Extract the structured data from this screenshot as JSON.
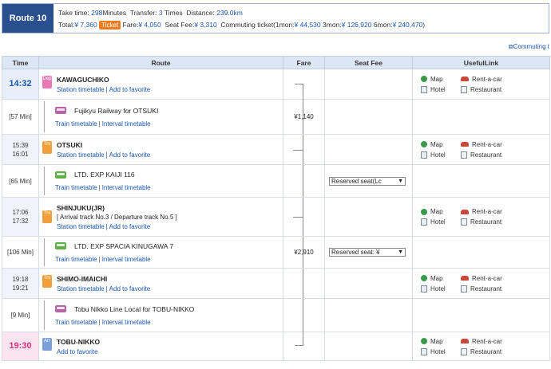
{
  "summary": {
    "route_label": "Route 10",
    "take_time_label": "Take time:",
    "take_time_value": "298",
    "take_time_unit": "Minutes",
    "transfer_label": "Transfer:",
    "transfer_value": "3",
    "transfer_unit": "Times",
    "distance_label": "Distance:",
    "distance_value": "239.0km",
    "total_label": "Total:",
    "total_value": "¥ 7,360",
    "ticket_badge": "Ticket",
    "fare_label": "Fare:",
    "fare_value": "¥ 4,050",
    "seat_fee_label": "Seat Fee:",
    "seat_fee_value": "¥ 3,310",
    "commuting_label": "Commuting ticket(1mon:",
    "commuting_1mon": "¥ 44,530",
    "commuting_3mon_label": "3mon:",
    "commuting_3mon": "¥ 126,920",
    "commuting_6mon_label": "6mon:",
    "commuting_6mon": "¥ 240,470",
    "commuting_close": ")"
  },
  "commuting_link": "Commuting t",
  "headers": {
    "time": "Time",
    "route": "Route",
    "fare": "Fare",
    "seat_fee": "Seat Fee",
    "useful_link": "UsefulLink"
  },
  "links": {
    "station_timetable": "Station timetable",
    "add_favorite": "Add to favorite",
    "train_timetable": "Train timetable",
    "interval_timetable": "Interval timetable",
    "map": "Map",
    "rent_a_car": "Rent-a-car",
    "hotel": "Hotel",
    "restaurant": "Restaurant"
  },
  "rows": [
    {
      "kind": "station",
      "time1": "14:32",
      "time2": "",
      "icon": "Dep",
      "name": "KAWAGUCHIKO",
      "note": ""
    },
    {
      "kind": "seg",
      "duration": "[57 Min]",
      "train": "Fujikyu Railway  for OTSUKI",
      "fare": "¥1,140",
      "seat": ""
    },
    {
      "kind": "station",
      "time1": "15:39",
      "time2": "16:01",
      "icon": "Trs",
      "name": "OTSUKI",
      "note": ""
    },
    {
      "kind": "seg",
      "duration": "[65 Min]",
      "train": "LTD. EXP KAIJI 116",
      "fare": "",
      "seat": "Reserved seat(Lc"
    },
    {
      "kind": "station",
      "time1": "17:06",
      "time2": "17:32",
      "icon": "Trs",
      "name": "SHINJUKU(JR)",
      "note": "[ Arrival track No.3 / Departure track No.5 ]"
    },
    {
      "kind": "seg",
      "duration": "[106 Min]",
      "train": "LTD. EXP SPACIA KINUGAWA 7",
      "fare": "¥2,910",
      "seat": "Reserved seat: ¥"
    },
    {
      "kind": "station",
      "time1": "19:18",
      "time2": "19:21",
      "icon": "Trs",
      "name": "SHIMO-IMAICHI",
      "note": ""
    },
    {
      "kind": "seg",
      "duration": "[9 Min]",
      "train": "Tobu Nikko Line Local  for TOBU-NIKKO",
      "fare": "",
      "seat": ""
    },
    {
      "kind": "station",
      "time1": "19:30",
      "time2": "",
      "icon": "Arr",
      "name": "TOBU-NIKKO",
      "note": ""
    }
  ],
  "colors": {
    "route_tab": "#2a4f8f",
    "dep_time": "#1a56b0",
    "arr_time": "#d8347a",
    "ticket_badge": "#f07b1e"
  }
}
